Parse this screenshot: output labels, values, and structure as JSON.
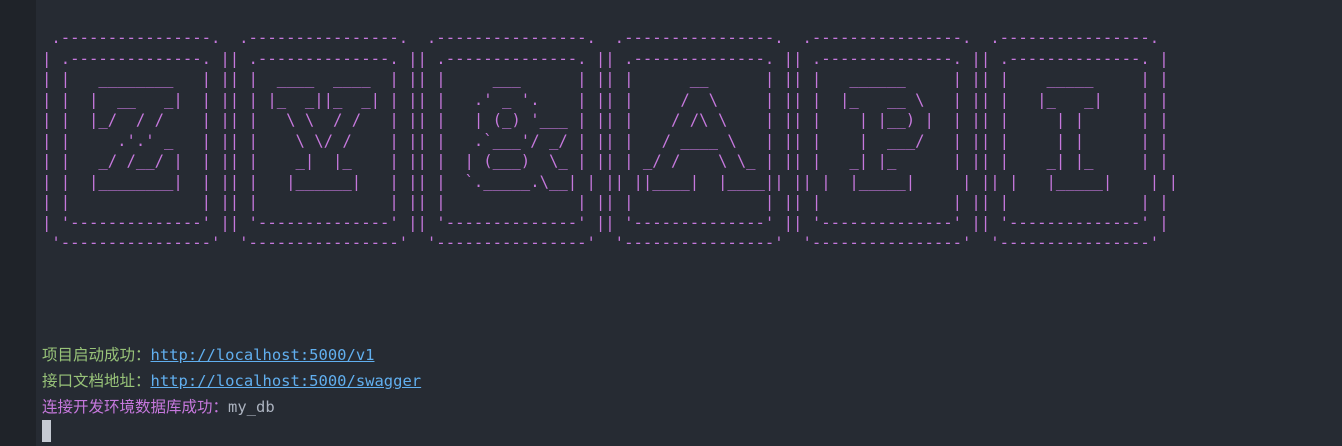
{
  "banner": {
    "ascii_art": " .----------------.  .----------------.  .----------------.  .----------------.  .----------------.  .----------------.\n| .--------------. || .--------------. || .--------------. || .--------------. || .--------------. || .--------------. |\n| |   ________   | || |  ____  ____  | || |     ___      | || |      __      | || |   ______     | || |    _____     | |\n| |  |  __   _|  | || | |_  _||_  _| | || |   .' _ '.    | || |     /  \\     | || |  |_   __ \\   | || |   |_   _|    | |\n| |  |_/  / /    | || |   \\ \\  / /   | || |   | (_) '___ | || |    / /\\ \\    | || |    | |__) |  | || |     | |      | |\n| |     .'.' _   | || |    \\ \\/ /    | || |   .`___'/ _/ | || |   / ____ \\   | || |    |  ___/   | || |     | |      | |\n| |   _/ /__/ |  | || |    _|  |_    | || |  | (___)  \\_ | || | _/ /    \\ \\_ | || |   _| |_      | || |    _| |_     | |\n| |  |________|  | || |   |______|   | || |  `._____.\\__| | || ||____|  |____|| || |  |_____|     | || |   |_____|    | |\n| |              | || |              | || |              | || |              | || |              | || |              | |\n| '--------------' || '--------------' || '--------------' || '--------------' || '--------------' || '--------------' |\n '----------------'  '----------------'  '----------------'  '----------------'  '----------------'  '----------------'"
  },
  "log": {
    "project_started_label": "项目启动成功：",
    "project_url": "http://localhost:5000/v1",
    "api_docs_label": "接口文档地址：",
    "api_docs_url": "http://localhost:5000/swagger",
    "db_connected_label": "连接开发环境数据库成功：",
    "db_name": "my_db"
  },
  "colors": {
    "background": "#262b33",
    "banner": "#c678dd",
    "label_green": "#98c379",
    "label_purple": "#c678dd",
    "link": "#61afef",
    "text": "#abb2bf",
    "cursor": "#c5cad3"
  }
}
